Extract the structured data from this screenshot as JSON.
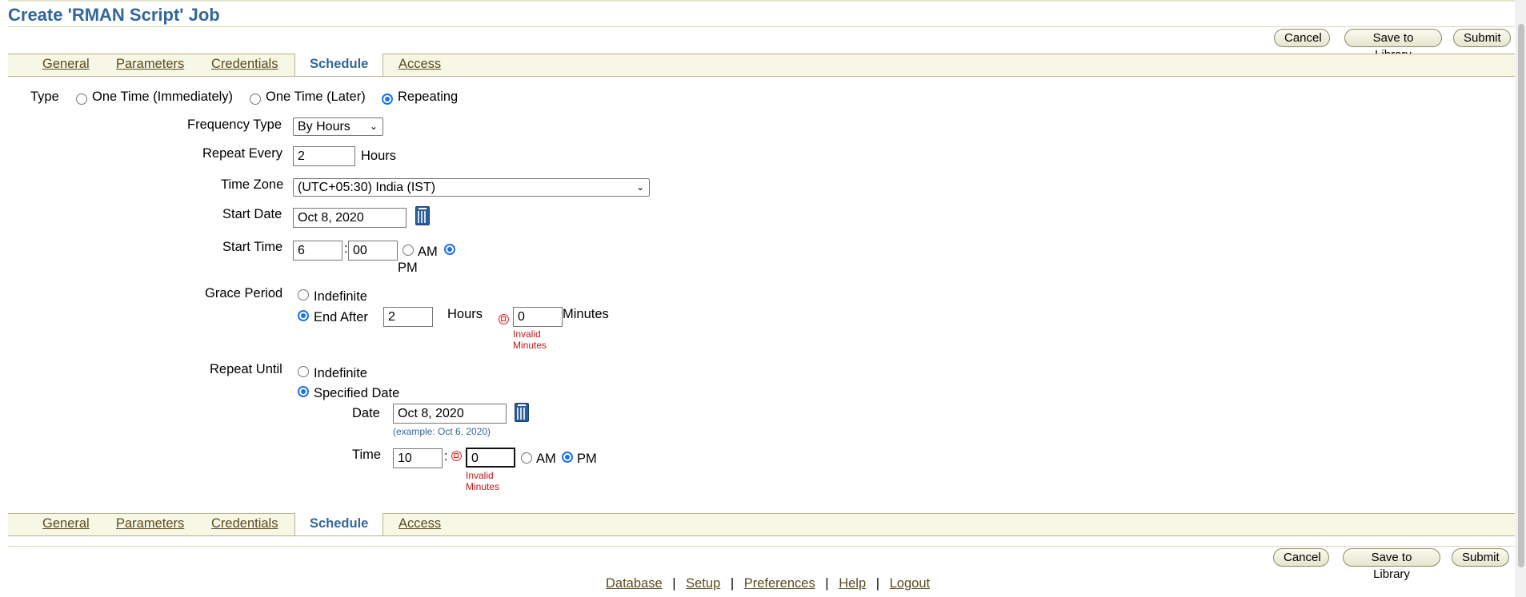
{
  "page": {
    "title": "Create 'RMAN Script' Job"
  },
  "buttons": {
    "cancel": "Cancel",
    "save_to_library": "Save to Library",
    "submit": "Submit"
  },
  "tabs": {
    "general": "General",
    "parameters": "Parameters",
    "credentials": "Credentials",
    "schedule": "Schedule",
    "access": "Access",
    "active": "Schedule"
  },
  "form": {
    "type": {
      "label": "Type",
      "options": [
        "One Time (Immediately)",
        "One Time (Later)",
        "Repeating"
      ],
      "selected": "Repeating"
    },
    "frequency_type": {
      "label": "Frequency Type",
      "value": "By Hours"
    },
    "repeat_every": {
      "label": "Repeat Every",
      "value": "2",
      "unit": "Hours"
    },
    "time_zone": {
      "label": "Time Zone",
      "value": "(UTC+05:30) India (IST)"
    },
    "start_date": {
      "label": "Start Date",
      "value": "Oct 8, 2020"
    },
    "start_time": {
      "label": "Start Time",
      "hour": "6",
      "minute": "00",
      "am": "AM",
      "pm": "PM",
      "selected": "PM",
      "sep": ":"
    },
    "grace_period": {
      "label": "Grace Period",
      "indefinite": "Indefinite",
      "end_after": "End After",
      "selected": "End After",
      "hours_value": "2",
      "hours_label": "Hours",
      "minutes_value": "0",
      "minutes_label": "Minutes",
      "error_line1": "Invalid",
      "error_line2": "Minutes"
    },
    "repeat_until": {
      "label": "Repeat Until",
      "indefinite": "Indefinite",
      "specified_date": "Specified Date",
      "selected": "Specified Date",
      "date_label": "Date",
      "date_value": "Oct 8, 2020",
      "date_hint": "(example: Oct 6, 2020)",
      "time_label": "Time",
      "hour": "10",
      "minute": "0",
      "sep": ":",
      "am": "AM",
      "pm": "PM",
      "time_selected": "PM",
      "error_line1": "Invalid",
      "error_line2": "Minutes"
    }
  },
  "footer": {
    "links": [
      "Database",
      "Setup",
      "Preferences",
      "Help",
      "Logout"
    ],
    "separator": "|"
  }
}
